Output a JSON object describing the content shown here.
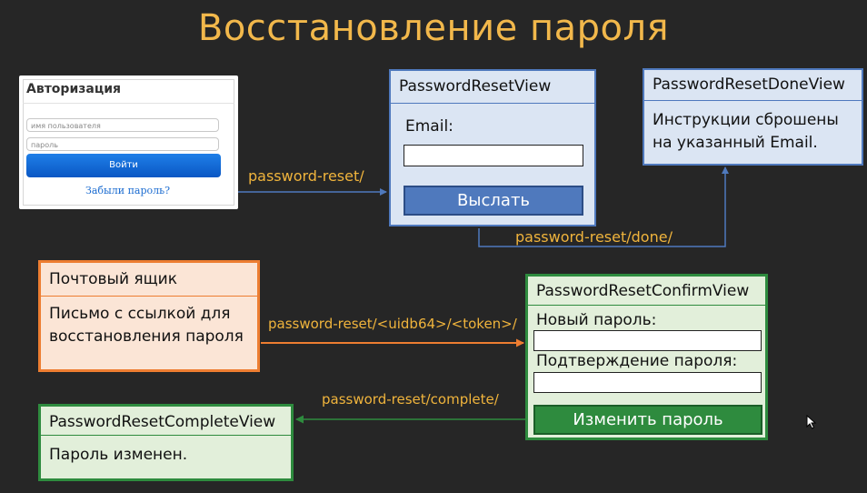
{
  "slide": {
    "title": "Восстановление пароля"
  },
  "login": {
    "title": "Авторизация",
    "username_placeholder": "имя пользователя",
    "password_placeholder": "пароль",
    "submit_label": "Войти",
    "forgot_link": "Забыли пароль?"
  },
  "password_reset_view": {
    "name": "PasswordResetView",
    "email_label": "Email:",
    "send_button": "Выслать"
  },
  "password_reset_done_view": {
    "name": "PasswordResetDoneView",
    "message": "Инструкции сброшены на указанный Email."
  },
  "mailbox": {
    "title": "Почтовый ящик",
    "message": "Письмо с ссылкой для восстановления пароля"
  },
  "password_reset_confirm_view": {
    "name": "PasswordResetConfirmView",
    "new_password_label": "Новый пароль:",
    "confirm_password_label": "Подтверждение пароля:",
    "change_button": "Изменить пароль"
  },
  "password_reset_complete_view": {
    "name": "PasswordResetCompleteView",
    "message": "Пароль изменен."
  },
  "routes": {
    "reset": "password-reset/",
    "done": "password-reset/done/",
    "confirm": "password-reset/<uidb64>/<token>/",
    "complete": "password-reset/complete/"
  },
  "colors": {
    "title": "#f2b84b",
    "blue_box": "#dbe5f3",
    "blue_border": "#4f79bd",
    "orange_box": "#fbe5d6",
    "orange_border": "#ed7d31",
    "green_box": "#e2efda",
    "green_border": "#2e8b3e",
    "route_text": "#f0b43c"
  },
  "icons": {
    "cursor": "mouse-pointer-icon"
  }
}
